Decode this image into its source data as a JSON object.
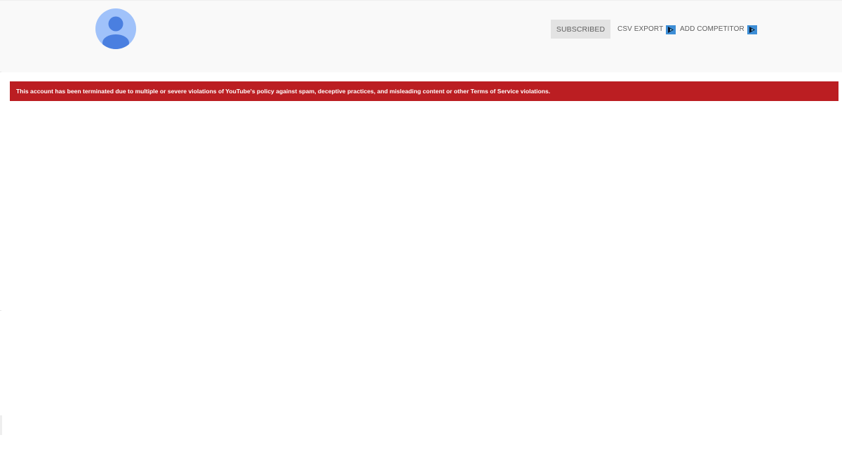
{
  "header": {
    "avatar_icon": "default-user-avatar-icon",
    "subscribe_label": "SUBSCRIBED",
    "csv_export_label": "CSV EXPORT",
    "add_competitor_label": "ADD COMPETITOR",
    "extension_icon": "vidiq-extension-icon"
  },
  "banner": {
    "message": "This account has been terminated due to multiple or severe violations of YouTube's policy against spam, deceptive practices, and misleading content or other Terms of Service violations."
  },
  "colors": {
    "header_bg": "#f9f9f9",
    "avatar_bg": "#a0c2fa",
    "avatar_figure": "#4a7fe0",
    "banner_bg": "#bb1e22",
    "extension_icon_bg": "#3d8ed6",
    "button_bg": "#e3e3e3"
  }
}
